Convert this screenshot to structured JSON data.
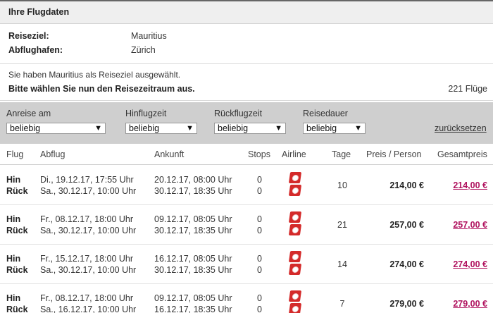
{
  "panel": {
    "title": "Ihre Flugdaten"
  },
  "info": {
    "destination_label": "Reiseziel:",
    "destination_value": "Mauritius",
    "airport_label": "Abflughafen:",
    "airport_value": "Zürich"
  },
  "notice": {
    "line1": "Sie haben Mauritius als Reiseziel ausgewählt.",
    "line2": "Bitte wählen Sie nun den Reisezeitraum aus.",
    "count": "221 Flüge"
  },
  "filters": {
    "anreise": {
      "label": "Anreise am",
      "value": "beliebig"
    },
    "hinflugzeit": {
      "label": "Hinflugzeit",
      "value": "beliebig"
    },
    "rueckflugzeit": {
      "label": "Rückflugzeit",
      "value": "beliebig"
    },
    "reisedauer": {
      "label": "Reisedauer",
      "value": "beliebig"
    },
    "reset": "zurücksetzen"
  },
  "columns": {
    "flug": "Flug",
    "abflug": "Abflug",
    "ankunft": "Ankunft",
    "stops": "Stops",
    "airline": "Airline",
    "tage": "Tage",
    "preis": "Preis / Person",
    "gesamt": "Gesamtpreis"
  },
  "labels": {
    "hin": "Hin",
    "rueck": "Rück"
  },
  "airline_icon": "red-airline-logo",
  "colors": {
    "price_link": "#b0135f",
    "filter_bar": "#cfcfcf",
    "airline_logo": "#d42a2a"
  },
  "rows": [
    {
      "hin_abflug": "Di., 19.12.17, 17:55 Uhr",
      "rueck_abflug": "Sa., 30.12.17, 10:00 Uhr",
      "hin_ankunft": "20.12.17, 08:00 Uhr",
      "rueck_ankunft": "30.12.17, 18:35 Uhr",
      "hin_stops": "0",
      "rueck_stops": "0",
      "tage": "10",
      "preis": "214,00 €",
      "gesamt": "214,00 €"
    },
    {
      "hin_abflug": "Fr., 08.12.17, 18:00 Uhr",
      "rueck_abflug": "Sa., 30.12.17, 10:00 Uhr",
      "hin_ankunft": "09.12.17, 08:05 Uhr",
      "rueck_ankunft": "30.12.17, 18:35 Uhr",
      "hin_stops": "0",
      "rueck_stops": "0",
      "tage": "21",
      "preis": "257,00 €",
      "gesamt": "257,00 €"
    },
    {
      "hin_abflug": "Fr., 15.12.17, 18:00 Uhr",
      "rueck_abflug": "Sa., 30.12.17, 10:00 Uhr",
      "hin_ankunft": "16.12.17, 08:05 Uhr",
      "rueck_ankunft": "30.12.17, 18:35 Uhr",
      "hin_stops": "0",
      "rueck_stops": "0",
      "tage": "14",
      "preis": "274,00 €",
      "gesamt": "274,00 €"
    },
    {
      "hin_abflug": "Fr., 08.12.17, 18:00 Uhr",
      "rueck_abflug": "Sa., 16.12.17, 10:00 Uhr",
      "hin_ankunft": "09.12.17, 08:05 Uhr",
      "rueck_ankunft": "16.12.17, 18:35 Uhr",
      "hin_stops": "0",
      "rueck_stops": "0",
      "tage": "7",
      "preis": "279,00 €",
      "gesamt": "279,00 €"
    }
  ]
}
